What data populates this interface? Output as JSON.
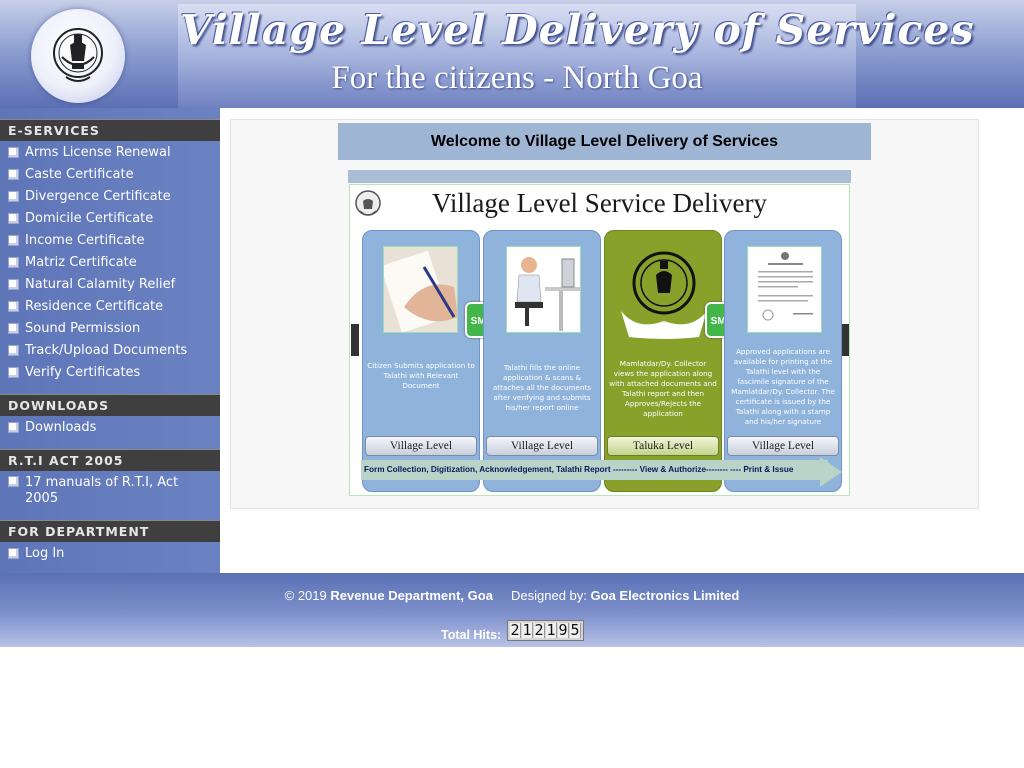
{
  "header": {
    "title": "Village Level Delivery of Services",
    "subtitle": "For the citizens - North Goa",
    "emblem_icon": "goa-government-seal-icon"
  },
  "sidebar": {
    "sections": [
      {
        "heading": "E-SERVICES",
        "items": [
          "Arms License Renewal",
          "Caste Certificate",
          "Divergence Certificate",
          "Domicile Certificate",
          "Income Certificate",
          "Matriz Certificate",
          "Natural Calamity Relief",
          "Residence Certificate",
          "Sound Permission",
          "Track/Upload Documents",
          "Verify Certificates"
        ]
      },
      {
        "heading": "DOWNLOADS",
        "items": [
          "Downloads"
        ]
      },
      {
        "heading": "R.T.I ACT 2005",
        "items": [
          "17 manuals of R.T.I, Act 2005"
        ]
      },
      {
        "heading": "FOR DEPARTMENT",
        "items": [
          "Log In"
        ]
      }
    ]
  },
  "main": {
    "welcome": "Welcome to Village Level Delivery of Services",
    "banner": {
      "title": "Village Level Service Delivery",
      "steps": [
        {
          "description": "Citizen Submits application to Talathi with Relevant Document",
          "level": "Village Level",
          "icon": "hand-signing-form-icon"
        },
        {
          "description": "Talathi fills the online application & scans & attaches all the documents after verifying and submits his/her report online",
          "level": "Village Level",
          "icon": "person-at-computer-icon"
        },
        {
          "description": "Mamlatdar/Dy. Collector views the application along with attached documents and Talathi report and then Approves/Rejects the application",
          "level": "Taluka Level",
          "icon": "government-seal-icon"
        },
        {
          "description": "Approved applications are available for printing at the Talathi level with the fascimile signature of the Mamlatdar/Dy. Collector. The certificate is issued by the Talathi along with a stamp and his/her signature",
          "level": "Village Level",
          "icon": "certificate-document-icon"
        }
      ],
      "sms_label": "SMS",
      "flow": "Form Collection, Digitization, Acknowledgement, Talathi Report --------- View & Authorize-------- ---- Print & Issue"
    }
  },
  "footer": {
    "copyright_prefix": "© 2019",
    "department": "Revenue Department, Goa",
    "designed_by_label": "Designed by:",
    "designer": "Goa Electronics Limited",
    "hits_label": "Total Hits:",
    "hits_value": "212195"
  },
  "colors": {
    "sidebar_bg": "#6b82c2",
    "section_header_bg": "#3f3f3f",
    "welcome_bg": "#9fb5d4",
    "step_blue": "#8fb3db",
    "step_green": "#88a12a",
    "sms_green": "#43b649"
  }
}
